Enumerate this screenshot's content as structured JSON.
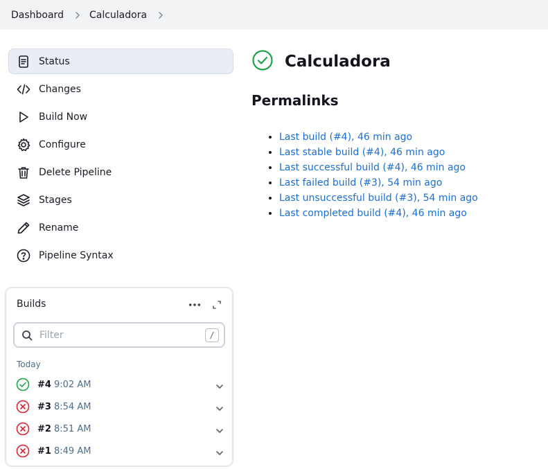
{
  "breadcrumb": {
    "items": [
      "Dashboard",
      "Calculadora"
    ]
  },
  "sidebar": {
    "items": [
      {
        "label": "Status",
        "icon": "document-icon",
        "active": true
      },
      {
        "label": "Changes",
        "icon": "code-icon"
      },
      {
        "label": "Build Now",
        "icon": "play-icon"
      },
      {
        "label": "Configure",
        "icon": "gear-icon"
      },
      {
        "label": "Delete Pipeline",
        "icon": "trash-icon"
      },
      {
        "label": "Stages",
        "icon": "layers-icon"
      },
      {
        "label": "Rename",
        "icon": "pencil-icon"
      },
      {
        "label": "Pipeline Syntax",
        "icon": "help-icon"
      }
    ]
  },
  "builds": {
    "title": "Builds",
    "filter_placeholder": "Filter",
    "filter_shortcut": "/",
    "group_label": "Today",
    "items": [
      {
        "number": "#4",
        "time": "9:02 AM",
        "status": "success"
      },
      {
        "number": "#3",
        "time": "8:54 AM",
        "status": "failed"
      },
      {
        "number": "#2",
        "time": "8:51 AM",
        "status": "failed"
      },
      {
        "number": "#1",
        "time": "8:49 AM",
        "status": "failed"
      }
    ]
  },
  "main": {
    "title": "Calculadora",
    "status": "success",
    "permalinks_heading": "Permalinks",
    "permalinks": [
      "Last build (#4), 46 min ago",
      "Last stable build (#4), 46 min ago",
      "Last successful build (#4), 46 min ago",
      "Last failed build (#3), 54 min ago",
      "Last unsuccessful build (#3), 54 min ago",
      "Last completed build (#4), 46 min ago"
    ]
  },
  "colors": {
    "success": "#1ea446",
    "failed": "#e0202e",
    "link": "#1a6fd6",
    "active_bg": "#e9eef4"
  }
}
